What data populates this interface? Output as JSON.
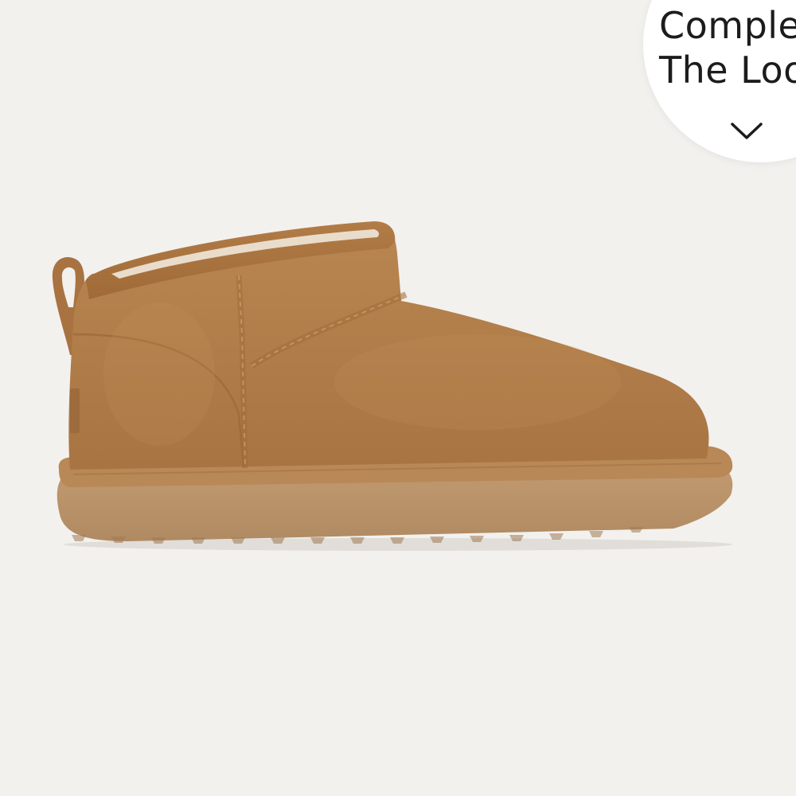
{
  "product": {
    "image_alt": "Tan suede ultra mini boot with fleece lining, side view",
    "color": "#b47d49"
  },
  "complete_look": {
    "label": "Complete\nThe Look",
    "icon": "chevron-down-icon"
  }
}
